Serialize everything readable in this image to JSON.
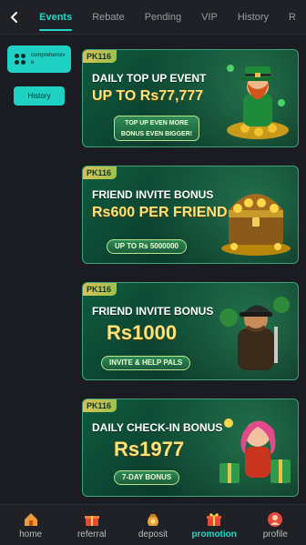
{
  "tabs": [
    "Events",
    "Rebate",
    "Pending",
    "VIP",
    "History",
    "R"
  ],
  "sidebar": {
    "category_label": "comprehensive",
    "history_label": "History"
  },
  "banners": [
    {
      "brand": "PK116",
      "line1": "DAILY TOP UP EVENT",
      "line2": "UP TO Rs77,777",
      "pill": "TOP UP EVEN MORE BONUS EVEN BIGGER!"
    },
    {
      "brand": "PK116",
      "line1": "FRIEND INVITE BONUS",
      "line2": "Rs600 PER FRIEND",
      "pill": "UP TO Rs 5000000"
    },
    {
      "brand": "PK116",
      "line1": "FRIEND INVITE BONUS",
      "line2": "Rs1000",
      "pill": "INVITE & HELP PALS"
    },
    {
      "brand": "PK116",
      "line1": "DAILY CHECK-IN BONUS",
      "line2": "Rs1977",
      "pill": "7-DAY BONUS"
    }
  ],
  "nav": [
    {
      "label": "home",
      "icon": "home-icon"
    },
    {
      "label": "referral",
      "icon": "gift-box-icon"
    },
    {
      "label": "deposit",
      "icon": "money-bag-icon"
    },
    {
      "label": "promotion",
      "icon": "present-icon"
    },
    {
      "label": "profile",
      "icon": "profile-icon"
    }
  ],
  "colors": {
    "accent": "#24d6c6",
    "background": "#1b1c21",
    "promotion_active": "#24d6c6"
  }
}
